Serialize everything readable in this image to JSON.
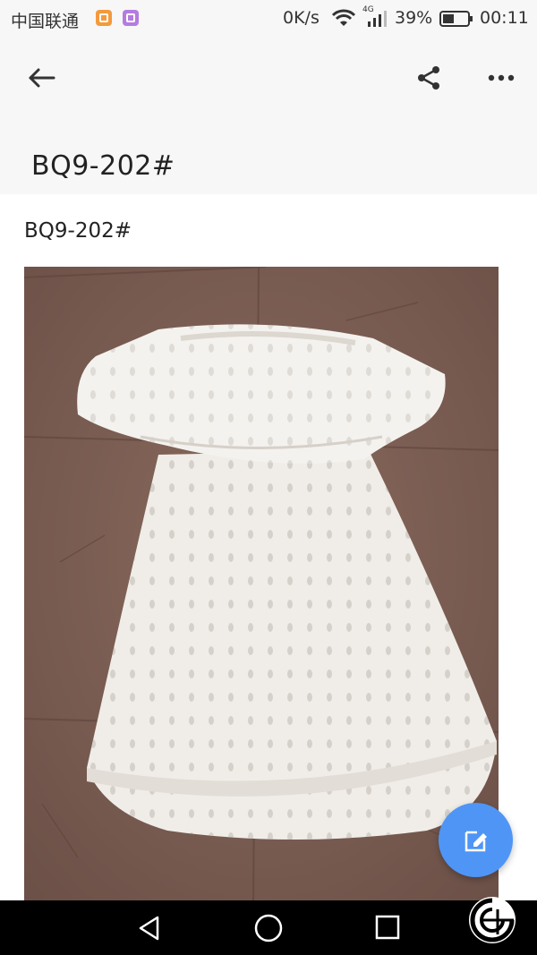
{
  "status_bar": {
    "carrier": "中国联通",
    "net_speed": "0K/s",
    "network_type": "4G",
    "battery": "39%",
    "time": "00:11",
    "icons": [
      "app-notification-icon",
      "gallery-notification-icon",
      "wifi-icon",
      "signal-icon",
      "battery-icon"
    ]
  },
  "toolbar": {
    "back_icon": "arrow-left-icon",
    "share_icon": "share-icon",
    "more_icon": "more-horizontal-icon"
  },
  "header": {
    "title": "BQ9-202#"
  },
  "content": {
    "text": "BQ9-202#",
    "image_subject": "white eyelet off-shoulder dress on brown tile floor"
  },
  "fab": {
    "icon": "edit-icon"
  },
  "nav_bar": {
    "icons": [
      "nav-back-icon",
      "nav-home-icon",
      "nav-recent-icon"
    ]
  },
  "colors": {
    "accent": "#4f95f5",
    "header_bg": "#f7f7f7",
    "nav_bg": "#000000"
  }
}
